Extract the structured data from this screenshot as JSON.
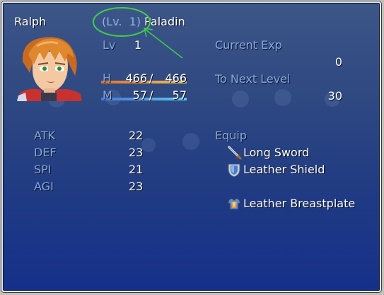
{
  "actor": {
    "name": "Ralph",
    "class_name": "Paladin",
    "level_label": "Lv",
    "level": "1",
    "annotated_level_text": "(Lv.  1)"
  },
  "gauges": {
    "hp_label": "H",
    "hp_current": "466",
    "hp_sep": "/",
    "hp_max": "466",
    "hp_fraction": 1.0,
    "mp_label": "M",
    "mp_current": "57",
    "mp_sep": "/",
    "mp_max": "57",
    "mp_fraction": 1.0
  },
  "exp": {
    "current_label": "Current Exp",
    "current_value": "0",
    "next_label": "To Next Level",
    "next_value": "30"
  },
  "params": [
    {
      "label": "ATK",
      "value": "22"
    },
    {
      "label": "DEF",
      "value": "23"
    },
    {
      "label": "SPI",
      "value": "21"
    },
    {
      "label": "AGI",
      "value": "23"
    }
  ],
  "equip": {
    "header": "Equip",
    "items": [
      {
        "icon": "sword-icon",
        "name": "Long Sword"
      },
      {
        "icon": "shield-icon",
        "name": "Leather Shield"
      },
      {
        "icon": "",
        "name": ""
      },
      {
        "icon": "armor-icon",
        "name": "Leather Breastplate"
      }
    ]
  },
  "colors": {
    "system_text": "#84a8de",
    "hp_bar": "#e8a040",
    "mp_bar": "#58a8e8",
    "annotation": "#3ed04a"
  }
}
